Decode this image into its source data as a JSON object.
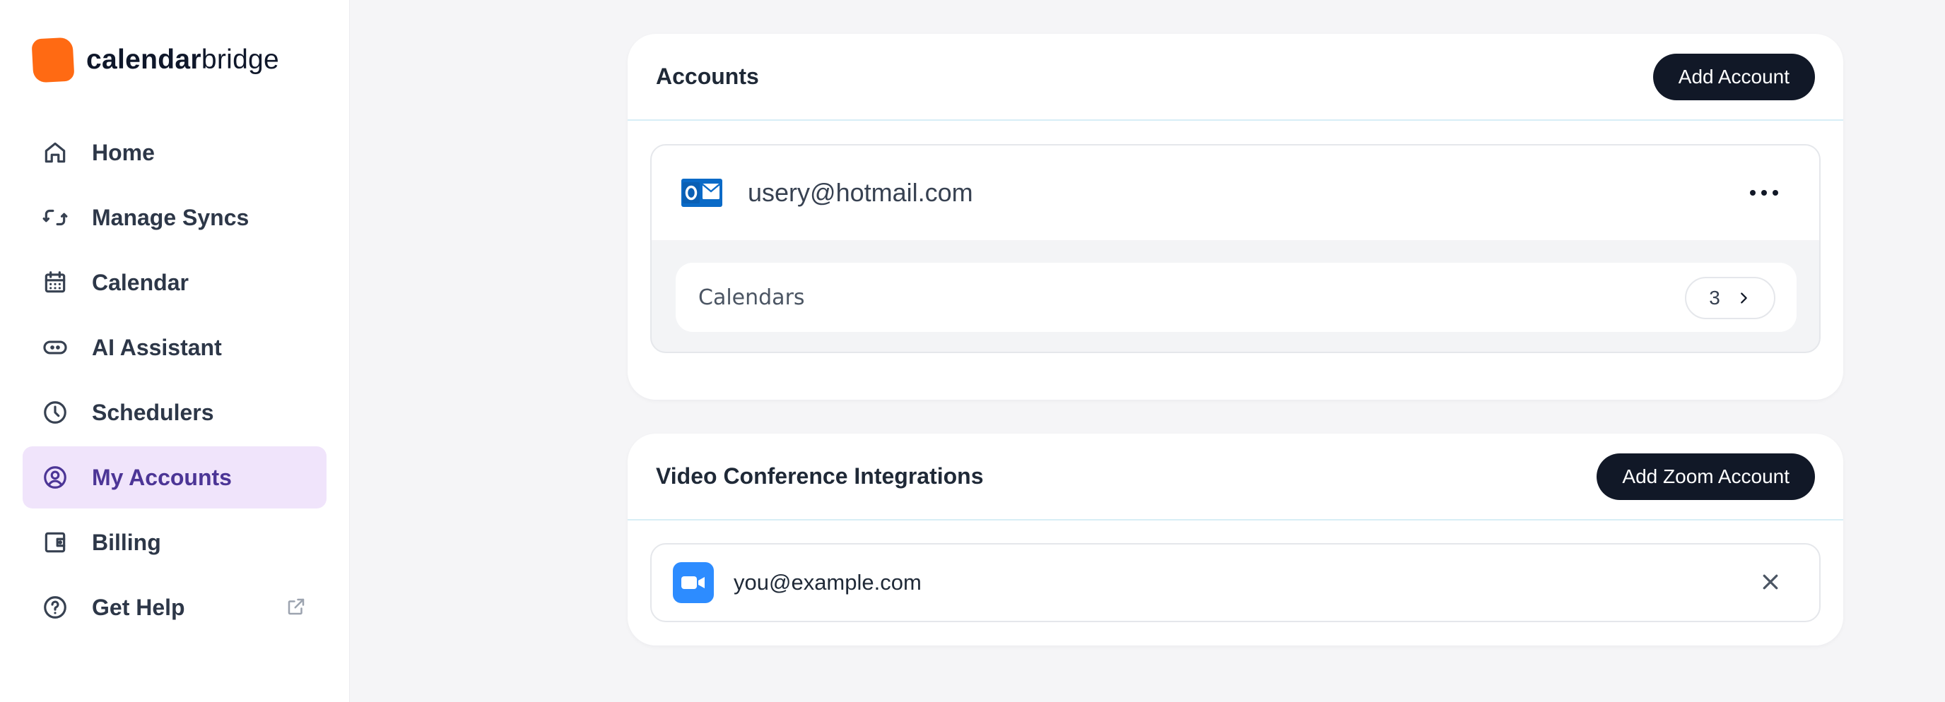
{
  "brand": {
    "name_bold": "calendar",
    "name_light": "bridge",
    "color": "#ff6a13"
  },
  "sidebar": {
    "items": [
      {
        "label": "Home",
        "icon": "home-icon",
        "active": false
      },
      {
        "label": "Manage Syncs",
        "icon": "sync-icon",
        "active": false
      },
      {
        "label": "Calendar",
        "icon": "calendar-icon",
        "active": false
      },
      {
        "label": "AI Assistant",
        "icon": "ai-assistant-icon",
        "active": false
      },
      {
        "label": "Schedulers",
        "icon": "clock-icon",
        "active": false
      },
      {
        "label": "My Accounts",
        "icon": "user-circle-icon",
        "active": true
      },
      {
        "label": "Billing",
        "icon": "wallet-icon",
        "active": false
      },
      {
        "label": "Get Help",
        "icon": "help-icon",
        "active": false,
        "external": true
      }
    ],
    "active_color": "#4c3596",
    "active_bg": "#f0e4fb"
  },
  "accounts": {
    "title": "Accounts",
    "add_button": "Add Account",
    "items": [
      {
        "email": "usery@hotmail.com",
        "provider_icon": "outlook-icon",
        "calendars_label": "Calendars",
        "calendars_count": "3"
      }
    ]
  },
  "video": {
    "title": "Video Conference Integrations",
    "add_button": "Add Zoom Account",
    "items": [
      {
        "email": "you@example.com",
        "provider_icon": "zoom-icon",
        "brand_color": "#2d8cff"
      }
    ]
  }
}
